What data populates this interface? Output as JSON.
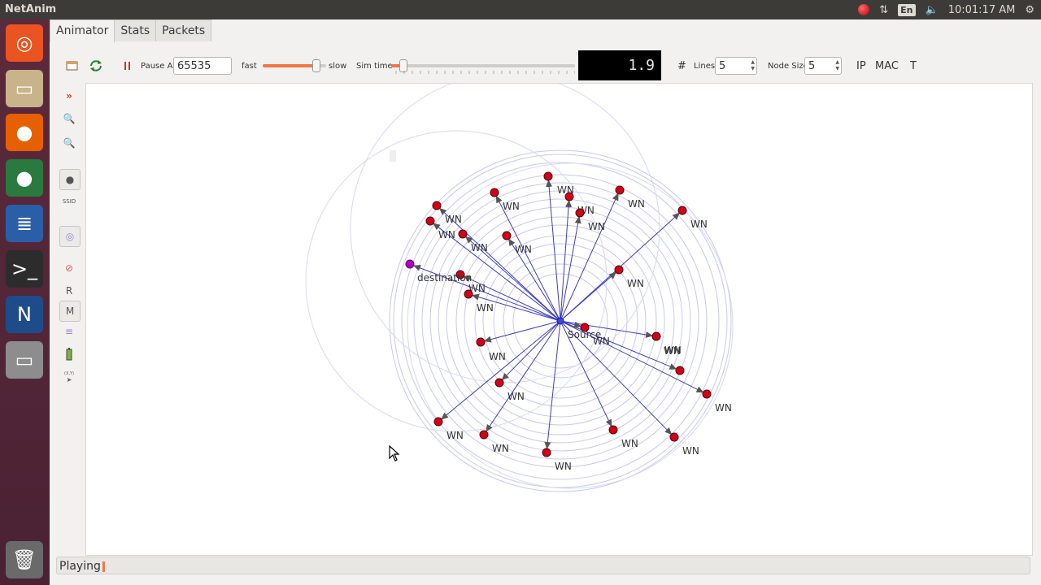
{
  "window": {
    "title": "NetAnim"
  },
  "tray": {
    "lang": "En",
    "time": "10:01:17 AM"
  },
  "launcher": [
    {
      "name": "ubuntu-dash",
      "glyph": "◎",
      "color": "#e95420"
    },
    {
      "name": "files",
      "glyph": "▭",
      "color": "#c8b38a"
    },
    {
      "name": "firefox",
      "glyph": "●",
      "color": "#e66000"
    },
    {
      "name": "globe",
      "glyph": "●",
      "color": "#2a7a3f"
    },
    {
      "name": "writer",
      "glyph": "≣",
      "color": "#2a5fa8"
    },
    {
      "name": "terminal",
      "glyph": ">_",
      "color": "#2c2c2c"
    },
    {
      "name": "netanim",
      "glyph": "N",
      "color": "#1e4c8a"
    },
    {
      "name": "drive",
      "glyph": "▭",
      "color": "#8d8d8d"
    },
    {
      "name": "trash",
      "glyph": "🗑",
      "color": "#6a6a6a"
    }
  ],
  "tabs": [
    "Animator",
    "Stats",
    "Packets"
  ],
  "toolbar": {
    "pause_at_label": "Pause At",
    "pause_at_value": "65535",
    "fast_label": "fast",
    "slow_label": "slow",
    "speed_level": 0.85,
    "sim_time_label": "Sim time",
    "sim_time_level": 0.0,
    "lcd_value": "1.9",
    "lines_label": "Lines",
    "lines_value": "5",
    "node_size_label": "Node Size",
    "node_size_value": "5",
    "ip_label": "IP",
    "mac_label": "MAC",
    "t_label": "T"
  },
  "sidetools": {
    "r_label": "R",
    "m_label": "M",
    "xy_label": "(X,Y)",
    "ssid_label": "SSID"
  },
  "status": {
    "text": "Playing"
  },
  "colors": {
    "accent": "#f07746",
    "node": "#d0021b",
    "destination": "#b000c8",
    "link": "#3d3dc4"
  },
  "network": {
    "source_label": "Source",
    "destination_label": "destination",
    "wn_label": "WN"
  }
}
